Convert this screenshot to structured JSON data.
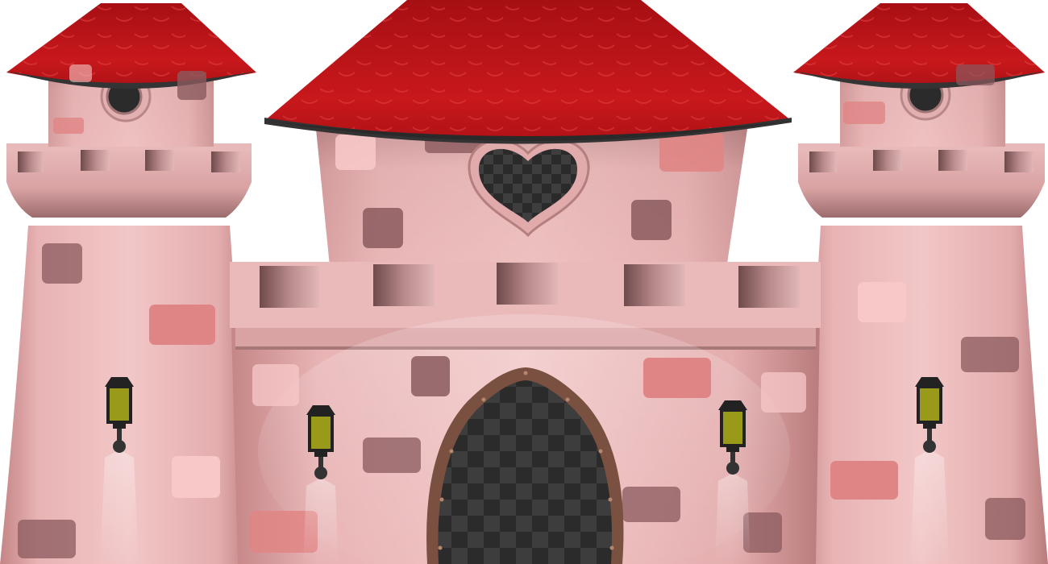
{
  "scene": {
    "subject": "pink-castle-illustration",
    "colors": {
      "background": "#ffffff",
      "roof": "#b81418",
      "roof_dark": "#8e0f12",
      "roof_rim": "#3a3a3a",
      "wall_light": "#f1c4c4",
      "wall_mid": "#d99a9b",
      "wall_dark": "#8e6565",
      "brick_dark": "#8a5a5e",
      "brick_red": "#e08585",
      "brick_pale": "#f7c8c8",
      "checker_dark": "#2a2a2a",
      "checker_light": "#3c3c3c",
      "door_frame": "#7a5040",
      "lamp_glass": "#9a9a1a",
      "lamp_metal": "#222222"
    }
  }
}
